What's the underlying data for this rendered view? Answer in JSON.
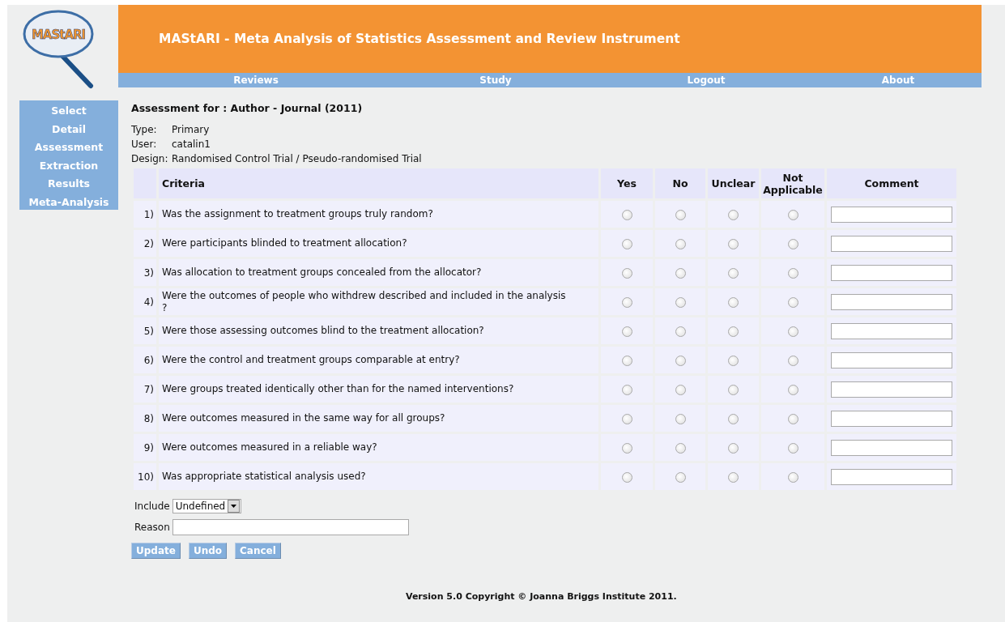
{
  "logo": {
    "text": "MAStARI"
  },
  "header": {
    "title": "MAStARI - Meta Analysis of Statistics Assessment and Review Instrument"
  },
  "nav": [
    "Reviews",
    "Study",
    "Logout",
    "About"
  ],
  "sidebar": {
    "items": [
      "Select",
      "Detail",
      "Assessment",
      "Extraction",
      "Results",
      "Meta-Analysis"
    ]
  },
  "assessment": {
    "heading": "Assessment for : Author - Journal (2011)",
    "info": [
      {
        "label": "Type:",
        "value": "Primary"
      },
      {
        "label": "User:",
        "value": "catalin1"
      },
      {
        "label": "Design:",
        "value": "Randomised Control Trial / Pseudo-randomised Trial"
      }
    ]
  },
  "table": {
    "columns": [
      "Criteria",
      "Yes",
      "No",
      "Unclear",
      "Not Applicable",
      "Comment"
    ],
    "rows": [
      {
        "number": "1)",
        "criterion": "Was the assignment to treatment groups truly random?",
        "choices": [
          {
            "selected": false
          },
          {
            "selected": false
          },
          {
            "selected": false
          },
          {
            "selected": false
          }
        ]
      },
      {
        "number": "2)",
        "criterion": "Were participants blinded to treatment allocation?",
        "choices": [
          {
            "selected": false
          },
          {
            "selected": false
          },
          {
            "selected": false
          },
          {
            "selected": false
          }
        ]
      },
      {
        "number": "3)",
        "criterion": "Was allocation to treatment groups concealed from the allocator?",
        "choices": [
          {
            "selected": false
          },
          {
            "selected": false
          },
          {
            "selected": false
          },
          {
            "selected": false
          }
        ]
      },
      {
        "number": "4)",
        "criterion": "Were the outcomes of people who withdrew described and included in the analysis ?",
        "choices": [
          {
            "selected": false
          },
          {
            "selected": false
          },
          {
            "selected": false
          },
          {
            "selected": false
          }
        ]
      },
      {
        "number": "5)",
        "criterion": "Were those assessing outcomes blind to the treatment allocation?",
        "choices": [
          {
            "selected": false
          },
          {
            "selected": false
          },
          {
            "selected": false
          },
          {
            "selected": false
          }
        ]
      },
      {
        "number": "6)",
        "criterion": "Were the control and treatment groups comparable at entry?",
        "choices": [
          {
            "selected": false
          },
          {
            "selected": false
          },
          {
            "selected": false
          },
          {
            "selected": false
          }
        ]
      },
      {
        "number": "7)",
        "criterion": "Were groups treated identically other than for the named interventions?",
        "choices": [
          {
            "selected": false
          },
          {
            "selected": false
          },
          {
            "selected": false
          },
          {
            "selected": false
          }
        ]
      },
      {
        "number": "8)",
        "criterion": "Were outcomes measured in the same way for all groups?",
        "choices": [
          {
            "selected": false
          },
          {
            "selected": false
          },
          {
            "selected": false
          },
          {
            "selected": false
          }
        ]
      },
      {
        "number": "9)",
        "criterion": "Were outcomes measured in a reliable way?",
        "choices": [
          {
            "selected": false
          },
          {
            "selected": false
          },
          {
            "selected": false
          },
          {
            "selected": false
          }
        ]
      },
      {
        "number": "10)",
        "criterion": "Was appropriate statistical analysis used?",
        "choices": [
          {
            "selected": false
          },
          {
            "selected": false
          },
          {
            "selected": false
          },
          {
            "selected": false
          }
        ]
      }
    ]
  },
  "include": {
    "label": "Include",
    "value": "Undefined"
  },
  "reason": {
    "label": "Reason"
  },
  "buttons": [
    "Update",
    "Undo",
    "Cancel"
  ],
  "footer": "Version 5.0 Copyright © Joanna Briggs Institute 2011."
}
